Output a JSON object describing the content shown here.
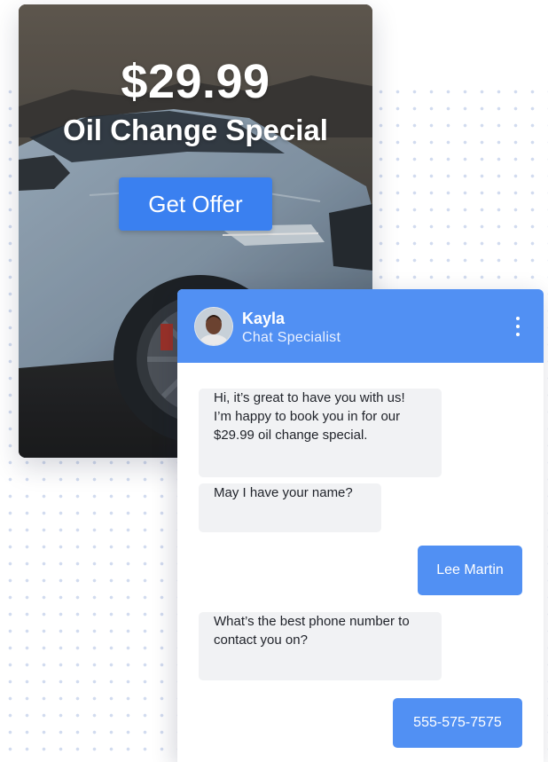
{
  "offer": {
    "price": "$29.99",
    "title": "Oil Change Special",
    "button_label": "Get Offer"
  },
  "chat": {
    "agent": {
      "name": "Kayla",
      "role": "Chat Specialist",
      "avatar_icon": "person-avatar-icon"
    },
    "menu_icon": "kebab-menu-icon",
    "messages": [
      {
        "from": "agent",
        "lines": [
          "Hi, it’s great to have you with us!",
          "I’m happy to book you in for our",
          "$29.99 oil change special."
        ]
      },
      {
        "from": "agent",
        "lines": [
          "May I have your name?"
        ]
      },
      {
        "from": "user",
        "lines": [
          "Lee Martin"
        ]
      },
      {
        "from": "agent",
        "lines": [
          "What’s the best phone number to",
          "contact you on?"
        ]
      },
      {
        "from": "user",
        "lines": [
          "555-575-7575"
        ]
      }
    ]
  },
  "colors": {
    "accent": "#5190f3",
    "offer_button": "#3a80f0",
    "agent_bubble": "#f1f2f4",
    "dot_pattern": "#cfd9ee"
  }
}
